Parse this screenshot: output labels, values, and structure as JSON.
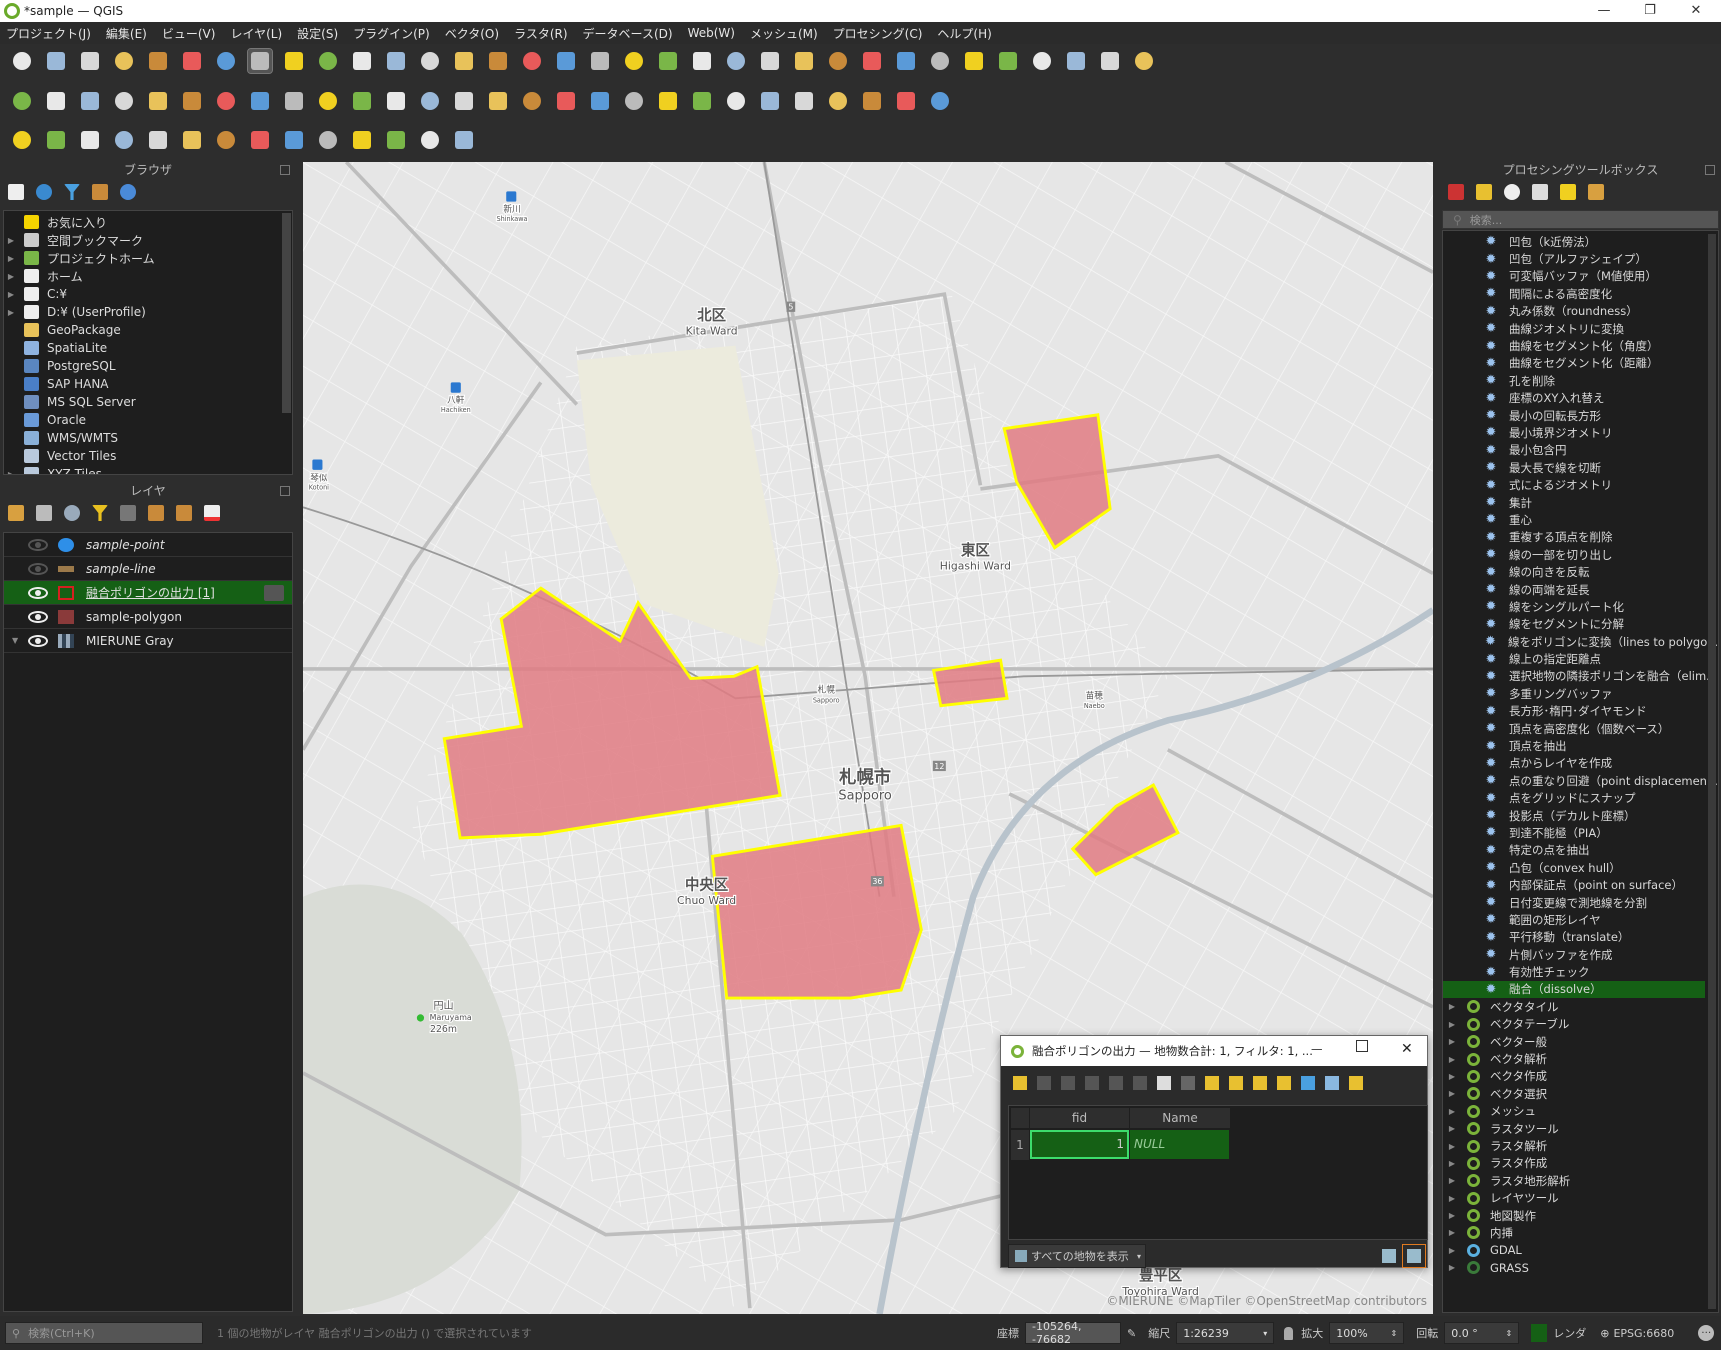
{
  "window": {
    "title": "*sample — QGIS",
    "minimize": "—",
    "maximize": "❐",
    "close": "✕"
  },
  "menu": [
    "プロジェクト(J)",
    "編集(E)",
    "ビュー(V)",
    "レイヤ(L)",
    "設定(S)",
    "プラグイン(P)",
    "ベクタ(O)",
    "ラスタ(R)",
    "データベース(D)",
    "Web(W)",
    "メッシュ(M)",
    "プロセシング(C)",
    "ヘルプ(H)"
  ],
  "toolbars": {
    "row1": [
      "new-project",
      "open-project",
      "save-project",
      "save-as",
      "new-print-layout",
      "layout-manager",
      "style-manager",
      "pan",
      "pan-to-selection",
      "zoom-in",
      "zoom-out",
      "zoom-full",
      "zoom-to-selection",
      "zoom-to-layer",
      "zoom-native",
      "zoom-last",
      "zoom-next",
      "new-map-view",
      "new-3d-view",
      "new-bookmark",
      "show-bookmarks",
      "temporal-controller",
      "refresh",
      "select-features",
      "deselect",
      "select-by-location",
      "identify",
      "attribute-table-open",
      "open-field-calculator",
      "statistics",
      "attribute-table",
      "measure",
      "map-tips",
      "annotation-settings"
    ],
    "row2": [
      "data-source-manager",
      "new-geopackage",
      "new-temporary-layer",
      "digitize",
      "current-edits",
      "toggle-editing",
      "save-edits",
      "add-feature",
      "vertex-tool",
      "modify-attributes",
      "delete-selected",
      "cut",
      "copy",
      "paste",
      "undo",
      "redo",
      "label-toolbar",
      "diagram",
      "pin-labels",
      "show-hide-labels",
      "label-move",
      "label-rotate",
      "label-change",
      "label-settings",
      "label-highlight",
      "metasearch",
      "python-console",
      "help"
    ],
    "row3": [
      "add-wms",
      "add-wfs",
      "add-spatialite",
      "add-delimited",
      "add-postgis",
      "add-xyz",
      "snapping",
      "advanced-digitizing",
      "georeference",
      "plugin-a",
      "plugin-b",
      "plugin-c",
      "info",
      "processing-tools"
    ]
  },
  "browser": {
    "title": "ブラウザ",
    "items": [
      {
        "label": "お気に入り",
        "icon": "star-icon",
        "color": "#f5d400",
        "expand": false
      },
      {
        "label": "空間ブックマーク",
        "icon": "bookmark-icon",
        "color": "#ccc",
        "expand": true
      },
      {
        "label": "プロジェクトホーム",
        "icon": "project-home-icon",
        "color": "#7ab648",
        "expand": true
      },
      {
        "label": "ホーム",
        "icon": "home-icon",
        "color": "#eee",
        "expand": true
      },
      {
        "label": "C:¥",
        "icon": "folder-icon",
        "color": "#eee",
        "expand": true
      },
      {
        "label": "D:¥ (UserProfile)",
        "icon": "folder-icon",
        "color": "#eee",
        "expand": true
      },
      {
        "label": "GeoPackage",
        "icon": "geopackage-icon",
        "color": "#e8c25a",
        "expand": false
      },
      {
        "label": "SpatiaLite",
        "icon": "spatialite-icon",
        "color": "#8fb3e0",
        "expand": false
      },
      {
        "label": "PostgreSQL",
        "icon": "postgresql-icon",
        "color": "#5a86c0",
        "expand": false
      },
      {
        "label": "SAP HANA",
        "icon": "sap-hana-icon",
        "color": "#4a7fc8",
        "expand": false
      },
      {
        "label": "MS SQL Server",
        "icon": "mssql-icon",
        "color": "#6f8fbf",
        "expand": false
      },
      {
        "label": "Oracle",
        "icon": "oracle-icon",
        "color": "#6a9ad8",
        "expand": false
      },
      {
        "label": "WMS/WMTS",
        "icon": "wms-icon",
        "color": "#8ab0d8",
        "expand": false
      },
      {
        "label": "Vector Tiles",
        "icon": "vector-tiles-icon",
        "color": "#b9c9dc",
        "expand": false
      },
      {
        "label": "XYZ Tiles",
        "icon": "xyz-tiles-icon",
        "color": "#b9c9dc",
        "expand": true
      }
    ]
  },
  "layers": {
    "title": "レイヤ",
    "items": [
      {
        "label": "sample-point",
        "visible": false,
        "italic": true,
        "swatch": "#2e8fe8",
        "shape": "circle",
        "selected": false
      },
      {
        "label": "sample-line",
        "visible": false,
        "italic": true,
        "swatch": "#9c7a4a",
        "shape": "line",
        "selected": false
      },
      {
        "label": "融合ポリゴンの出力 [1]",
        "visible": true,
        "italic": false,
        "swatch": "#d62020",
        "shape": "outline",
        "selected": true
      },
      {
        "label": "sample-polygon",
        "visible": true,
        "italic": false,
        "swatch": "#8a3a3a",
        "shape": "fill",
        "selected": false
      },
      {
        "label": "MIERUNE Gray",
        "visible": true,
        "italic": false,
        "swatch": "#9ab",
        "shape": "raster",
        "selected": false
      }
    ]
  },
  "processing": {
    "title": "プロセシングツールボックス",
    "search_placeholder": "検索...",
    "algorithms": [
      "凹包（k近傍法）",
      "凹包（アルファシェイプ）",
      "可変幅バッファ（M値使用）",
      "間隔による高密度化",
      "丸み係数（roundness）",
      "曲線ジオメトリに変換",
      "曲線をセグメント化（角度）",
      "曲線をセグメント化（距離）",
      "孔を削除",
      "座標のXY入れ替え",
      "最小の回転長方形",
      "最小境界ジオメトリ",
      "最小包含円",
      "最大長で線を切断",
      "式によるジオメトリ",
      "集計",
      "重心",
      "重複する頂点を削除",
      "線の一部を切り出し",
      "線の向きを反転",
      "線の両端を延長",
      "線をシングルパート化",
      "線をセグメントに分解",
      "線をポリゴンに変換（lines to polygo...",
      "線上の指定距離点",
      "選択地物の隣接ポリゴンを融合（elim...",
      "多重リングバッファ",
      "長方形･楕円･ダイヤモンド",
      "頂点を高密度化（個数ベース）",
      "頂点を抽出",
      "点からレイヤを作成",
      "点の重なり回避（point displacemen...",
      "点をグリッドにスナップ",
      "投影点（デカルト座標）",
      "到達不能極（PIA）",
      "特定の点を抽出",
      "凸包（convex hull）",
      "内部保証点（point on surface）",
      "日付変更線で測地線を分割",
      "範囲の矩形レイヤ",
      "平行移動（translate）",
      "片側バッファを作成",
      "有効性チェック",
      "融合（dissolve）"
    ],
    "selected": "融合（dissolve）",
    "groups": [
      "ベクタタイル",
      "ベクタテーブル",
      "ベクター般",
      "ベクタ解析",
      "ベクタ作成",
      "ベクタ選択",
      "メッシュ",
      "ラスタツール",
      "ラスタ解析",
      "ラスタ作成",
      "ラスタ地形解析",
      "レイヤツール",
      "地図製作",
      "内挿",
      "GDAL",
      "GRASS"
    ]
  },
  "map": {
    "labels": {
      "kita_ja": "北区",
      "kita_en": "Kita Ward",
      "higashi_ja": "東区",
      "higashi_en": "Higashi Ward",
      "sapporo_ja": "札幌市",
      "sapporo_en": "Sapporo",
      "chuo_ja": "中央区",
      "chuo_en": "Chuo Ward",
      "toyohira_ja": "豊平区",
      "toyohira_en": "Toyohira Ward",
      "maruyama_ja": "円山",
      "maruyama_en": "Maruyama",
      "maruyama_elev": "226m",
      "shinkawa_ja": "新川",
      "shinkawa_en": "Shinkawa",
      "hachiken_ja": "八軒",
      "hachiken_en": "Hachiken",
      "kotoni_ja": "琴似",
      "kotoni_en": "Kotoni",
      "station_ja": "札幌",
      "station_en": "Sapporo",
      "naebo_ja": "苗穂",
      "naebo_en": "Naebo",
      "route5": "5",
      "route12": "12",
      "route36": "36"
    },
    "attribution": "©MIERUNE ©MapTiler ©OpenStreetMap contributors",
    "polygon_fill": "#e07b82",
    "polygon_stroke": "#ffff00",
    "background": "#e6e6e6"
  },
  "attribute_table": {
    "title": "融合ポリゴンの出力 — 地物数合計: 1, フィルタ: 1, ...",
    "columns": [
      "fid",
      "Name"
    ],
    "rows": [
      {
        "row_num": "1",
        "fid": "1",
        "Name": "NULL"
      }
    ],
    "filter_button": "すべての地物を表示",
    "toolbar": [
      "toggle-editing",
      "multi-edit",
      "save-edits",
      "add-feature",
      "delete-feature",
      "cut",
      "copy",
      "paste",
      "select-by-expression",
      "select-all",
      "invert-selection",
      "deselect",
      "filter",
      "move-selection-to-top",
      "pan-to-selected"
    ]
  },
  "statusbar": {
    "search_placeholder": "検索(Ctrl+K)",
    "message": "1 個の地物がレイヤ 融合ポリゴンの出力 () で選択されています",
    "coord_label": "座標",
    "coord_value": "-105264, -76682",
    "scale_label": "縮尺",
    "scale_value": "1:26239",
    "magnifier_label": "拡大",
    "magnifier_value": "100%",
    "rotation_label": "回転",
    "rotation_value": "0.0 °",
    "render_label": "レンダ",
    "crs": "EPSG:6680"
  }
}
